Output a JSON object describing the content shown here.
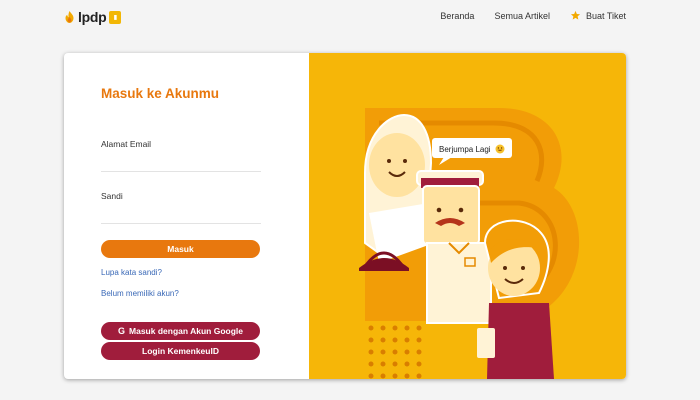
{
  "header": {
    "logo_text": "lpdp",
    "nav": {
      "home": "Beranda",
      "articles": "Semua Artikel",
      "ticket": "Buat Tiket"
    }
  },
  "login": {
    "title": "Masuk ke Akunmu",
    "email_label": "Alamat Email",
    "email_value": "",
    "password_label": "Sandi",
    "password_value": "",
    "submit": "Masuk",
    "forgot_link": "Lupa kata sandi?",
    "register_link": "Belum memiliki akun?",
    "google_button": "Masuk dengan Akun Google",
    "kemenkeu_button": "Login KemenkeuID"
  },
  "illustration": {
    "speech_bubble": "Berjumpa Lagi"
  },
  "colors": {
    "accent": "#e8780e",
    "secondary": "#a01d3c",
    "illustration_bg": "#f6b608",
    "link": "#3a69b7"
  }
}
